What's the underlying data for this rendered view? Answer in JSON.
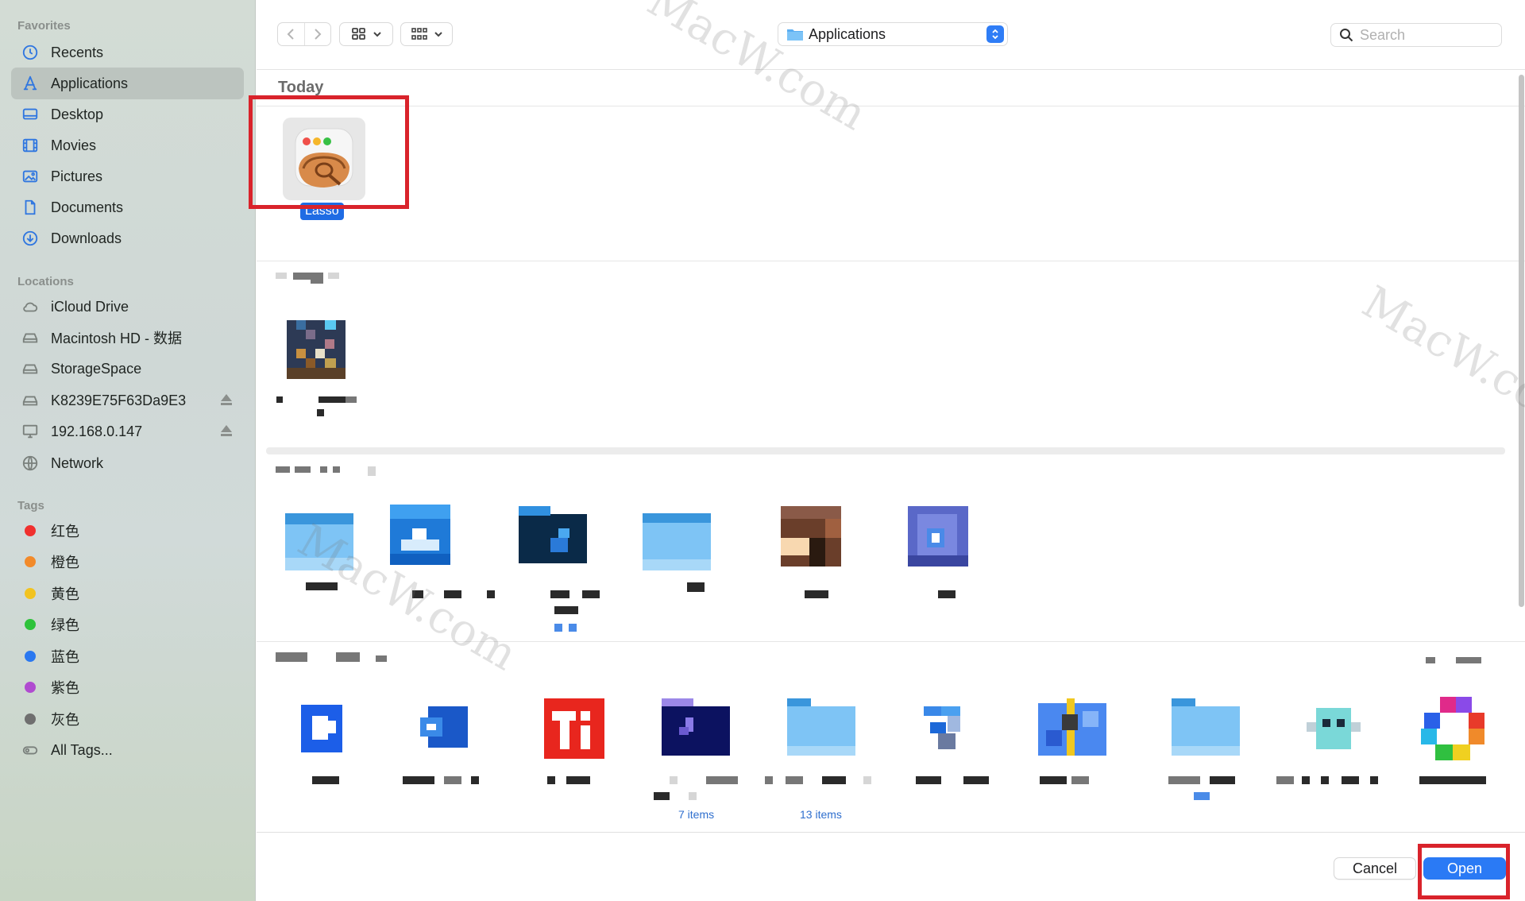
{
  "sidebar": {
    "favorites_label": "Favorites",
    "favorites": [
      {
        "label": "Recents",
        "icon": "clock-icon"
      },
      {
        "label": "Applications",
        "icon": "applications-icon",
        "active": true
      },
      {
        "label": "Desktop",
        "icon": "desktop-icon"
      },
      {
        "label": "Movies",
        "icon": "film-icon"
      },
      {
        "label": "Pictures",
        "icon": "photo-icon"
      },
      {
        "label": "Documents",
        "icon": "document-icon"
      },
      {
        "label": "Downloads",
        "icon": "download-icon"
      }
    ],
    "locations_label": "Locations",
    "locations": [
      {
        "label": "iCloud Drive",
        "icon": "cloud-icon"
      },
      {
        "label": "Macintosh HD - 数据",
        "icon": "drive-icon"
      },
      {
        "label": "StorageSpace",
        "icon": "drive-icon"
      },
      {
        "label": "K8239E75F63Da9E3",
        "icon": "drive-icon",
        "eject": true
      },
      {
        "label": "192.168.0.147",
        "icon": "monitor-icon",
        "eject": true
      },
      {
        "label": "Network",
        "icon": "globe-icon"
      }
    ],
    "tags_label": "Tags",
    "tags": [
      {
        "label": "红色",
        "color": "#f0302e"
      },
      {
        "label": "橙色",
        "color": "#f28a2a"
      },
      {
        "label": "黄色",
        "color": "#f2c320"
      },
      {
        "label": "绿色",
        "color": "#2ec23a"
      },
      {
        "label": "蓝色",
        "color": "#2a78f0"
      },
      {
        "label": "紫色",
        "color": "#b04bd0"
      },
      {
        "label": "灰色",
        "color": "#6f6f6f"
      }
    ],
    "all_tags_label": "All Tags..."
  },
  "toolbar": {
    "location": "Applications",
    "search_placeholder": "Search"
  },
  "content": {
    "group_today": "Today",
    "selected_app": "Lasso",
    "folder_counts": [
      "7 items",
      "13 items"
    ]
  },
  "footer": {
    "cancel_label": "Cancel",
    "open_label": "Open"
  },
  "watermark": "MacW.com",
  "colors": {
    "accent": "#2a7af5",
    "highlight_box": "#d9232b"
  }
}
